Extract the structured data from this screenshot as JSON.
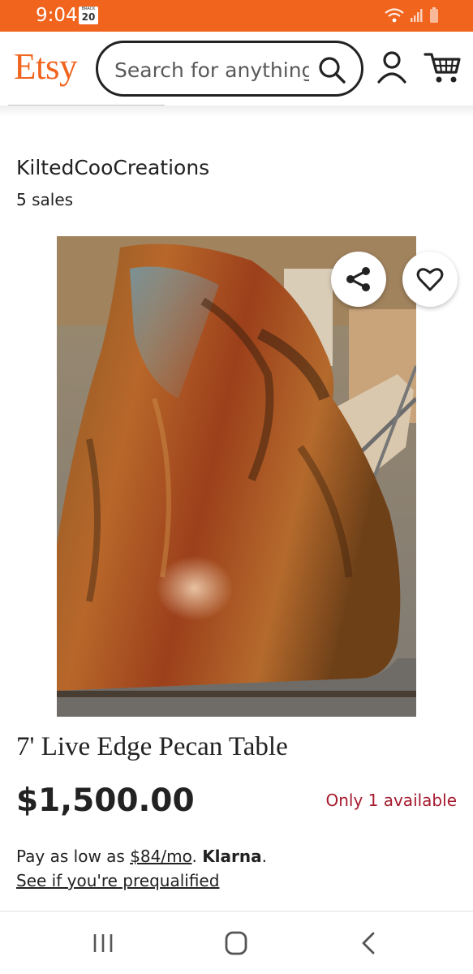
{
  "status_bar": {
    "time": "9:04",
    "badge_top": "BRACK\nMERCH",
    "badge_number": "20",
    "accent": "#f1641e"
  },
  "header": {
    "logo": "Etsy",
    "search_placeholder": "Search for anything",
    "icons": [
      "search-icon",
      "account-icon",
      "cart-icon"
    ]
  },
  "shop": {
    "name": "KiltedCooCreations",
    "sales": "5 sales"
  },
  "image_actions": {
    "icons": [
      "share-icon",
      "heart-icon"
    ]
  },
  "listing": {
    "title": "7' Live Edge Pecan Table",
    "price": "$1,500.00",
    "availability": "Only 1 available",
    "availability_color": "#a61a2e",
    "pay_prefix": "Pay as low as ",
    "pay_monthly": "$84/mo",
    "pay_middle": ". ",
    "pay_brand": "Klarna",
    "pay_suffix": ".",
    "prequal_link": "See if you're prequalified"
  },
  "nav_bar": {
    "icons": [
      "recent-apps-icon",
      "home-icon",
      "back-icon"
    ]
  }
}
